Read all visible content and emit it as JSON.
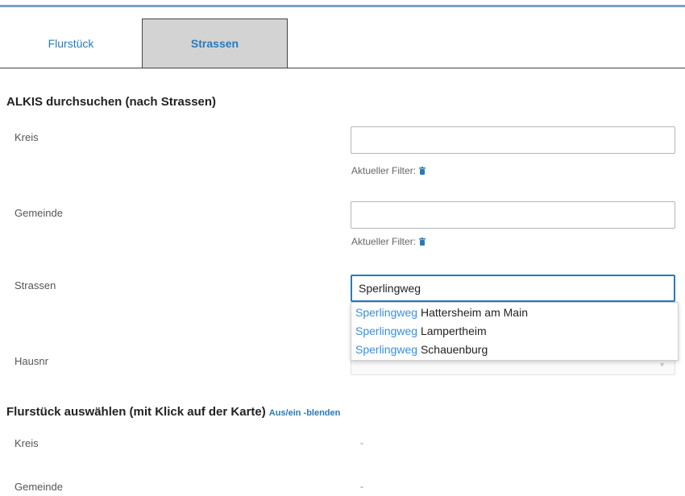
{
  "tabs": [
    {
      "label": "Flurstück"
    },
    {
      "label": "Strassen"
    }
  ],
  "search": {
    "title": "ALKIS durchsuchen (nach Strassen)",
    "kreis_label": "Kreis",
    "kreis_value": "",
    "filter_label": "Aktueller Filter:",
    "gemeinde_label": "Gemeinde",
    "gemeinde_value": "",
    "strassen_label": "Strassen",
    "strassen_value": "Sperlingweg",
    "hausnr_label": "Hausnr",
    "suggestions": [
      {
        "match": "Sperlingweg",
        "rest": " Hattersheim am Main"
      },
      {
        "match": "Sperlingweg",
        "rest": " Lampertheim"
      },
      {
        "match": "Sperlingweg",
        "rest": " Schauenburg"
      }
    ]
  },
  "select": {
    "title": "Flurstück auswählen (mit Klick auf der Karte)",
    "toggle_label": "Aus/ein -blenden",
    "rows": [
      {
        "label": "Kreis",
        "value": "-"
      },
      {
        "label": "Gemeinde",
        "value": "-"
      }
    ]
  },
  "colors": {
    "accent": "#2a7ab8",
    "topbar": "#7aa3c4",
    "active_tab": "#d3d3d3"
  },
  "icons": {
    "filter_clear": "trash-icon",
    "dropdown": "chevron-down-icon"
  }
}
